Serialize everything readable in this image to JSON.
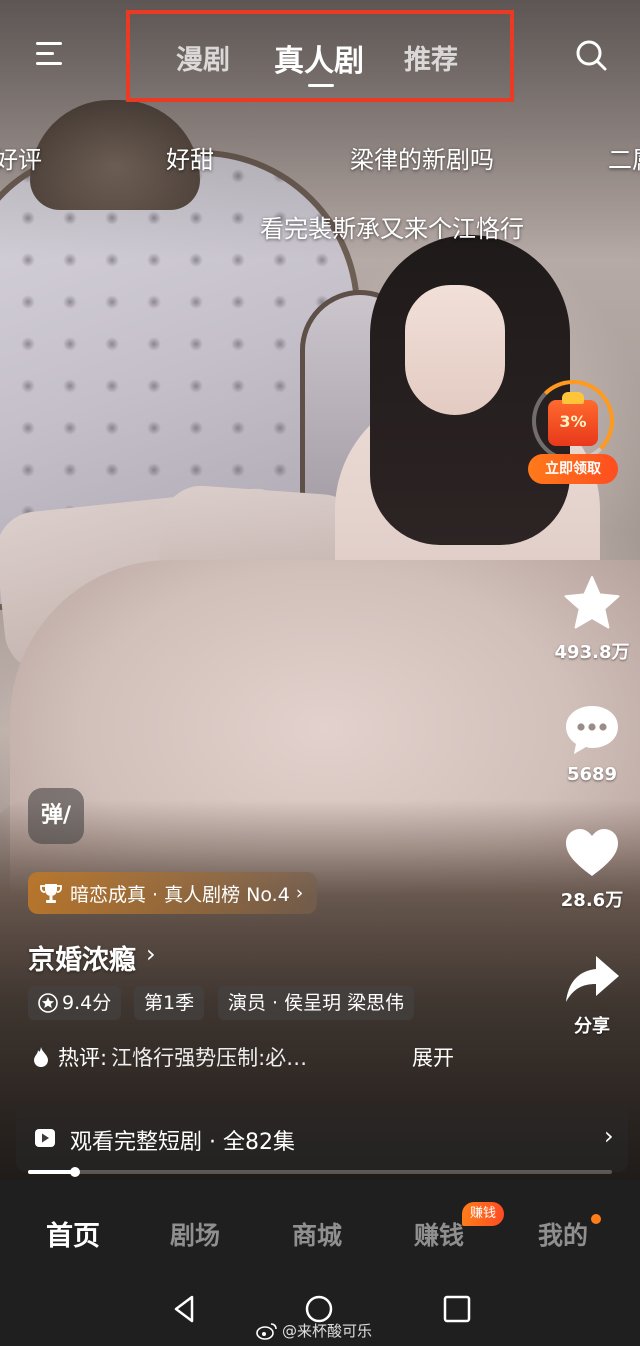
{
  "top_tabs": {
    "tabs": [
      {
        "label": "漫剧"
      },
      {
        "label": "真人剧"
      },
      {
        "label": "推荐"
      }
    ],
    "active_index": 1,
    "highlight_color": "#ea3a24"
  },
  "danmaku": [
    {
      "text": "好评"
    },
    {
      "text": "好甜"
    },
    {
      "text": "梁律的新剧吗"
    },
    {
      "text": "二属"
    },
    {
      "text": "看完裴斯承又来个江恪行"
    }
  ],
  "reward": {
    "amount": "3%",
    "label": "立即领取"
  },
  "side_actions": {
    "favorite": {
      "icon": "star-icon",
      "count": "493.8万"
    },
    "comment": {
      "icon": "comment-icon",
      "count": "5689"
    },
    "like": {
      "icon": "heart-icon",
      "count": "28.6万"
    },
    "share": {
      "icon": "share-icon",
      "label": "分享"
    }
  },
  "danmaku_toggle": {
    "label": "弹/"
  },
  "rank_badge": {
    "text": "暗恋成真 · 真人剧榜 No.4",
    "chevron": "›"
  },
  "show": {
    "title": "京婚浓瘾",
    "title_chevron": "›",
    "rating": "9.4分",
    "season": "第1季",
    "cast": "演员 · 侯呈玥 梁思伟"
  },
  "hot_review": {
    "label": "热评:",
    "text": "江恪行强势压制:必…",
    "expand": "展开"
  },
  "watch_full": {
    "text": "观看完整短剧 · 全82集",
    "chevron": "›"
  },
  "playback": {
    "progress_fraction": 0.08
  },
  "bottom_nav": {
    "items": [
      {
        "label": "首页"
      },
      {
        "label": "剧场"
      },
      {
        "label": "商城"
      },
      {
        "label": "赚钱"
      },
      {
        "label": "我的"
      }
    ],
    "active_index": 0,
    "earn_badge": "赚钱",
    "accent_color": "#ff7d1a"
  },
  "watermark": {
    "text": "@来杯酸可乐"
  }
}
